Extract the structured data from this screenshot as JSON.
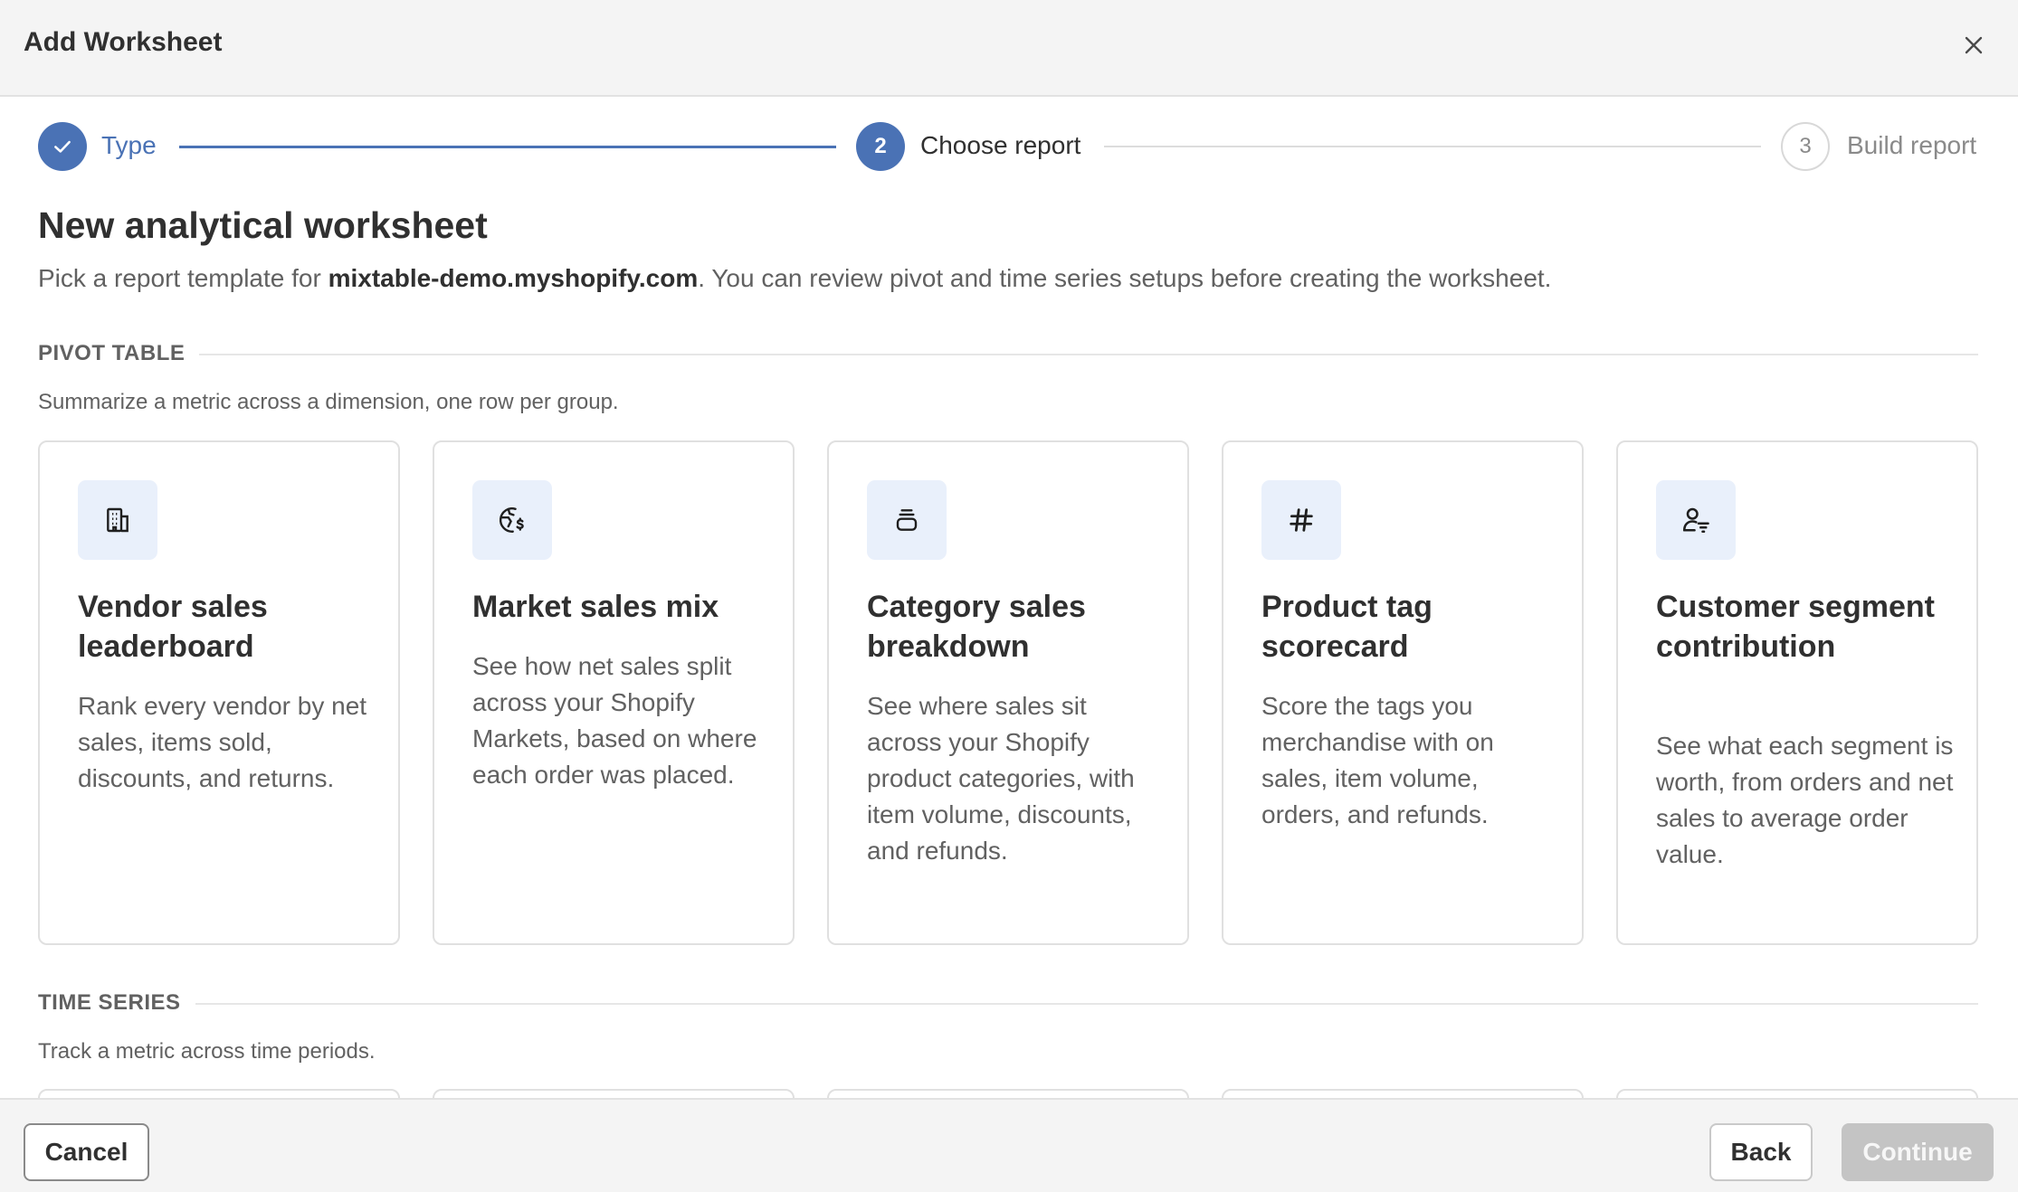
{
  "dialog": {
    "title": "Add Worksheet"
  },
  "stepper": {
    "steps": [
      {
        "number": "",
        "label": "Type",
        "state": "done"
      },
      {
        "number": "2",
        "label": "Choose report",
        "state": "active"
      },
      {
        "number": "3",
        "label": "Build report",
        "state": "pending"
      }
    ]
  },
  "intro": {
    "title": "New analytical worksheet",
    "subtitle_prefix": "Pick a report template for ",
    "store_domain": "mixtable-demo.myshopify.com",
    "subtitle_suffix": ". You can review pivot and time series setups before creating the worksheet."
  },
  "sections": {
    "pivot": {
      "heading": "PIVOT TABLE",
      "description": "Summarize a metric across a dimension, one row per group.",
      "cards": [
        {
          "icon": "building-icon",
          "title": "Vendor sales leaderboard",
          "description": "Rank every vendor by net sales, items sold, discounts, and returns."
        },
        {
          "icon": "globe-dollar-icon",
          "title": "Market sales mix",
          "description": "See how net sales split across your Shopify Markets, based on where each order was placed."
        },
        {
          "icon": "stack-icon",
          "title": "Category sales breakdown",
          "description": "See where sales sit across your Shopify product categories, with item volume, discounts, and refunds."
        },
        {
          "icon": "hashtag-icon",
          "title": "Product tag scorecard",
          "description": "Score the tags you merchandise with on sales, item volume, orders, and refunds."
        },
        {
          "icon": "user-filter-icon",
          "title": "Customer segment contribution",
          "description": "See what each segment is worth, from orders and net sales to average order value."
        }
      ]
    },
    "timeseries": {
      "heading": "TIME SERIES",
      "description": "Track a metric across time periods."
    }
  },
  "footer": {
    "cancel": "Cancel",
    "back": "Back",
    "continue": "Continue"
  },
  "colors": {
    "accent": "#4a72b5",
    "icon_bg": "#e9f0fb",
    "disabled": "#c4c4c4"
  }
}
